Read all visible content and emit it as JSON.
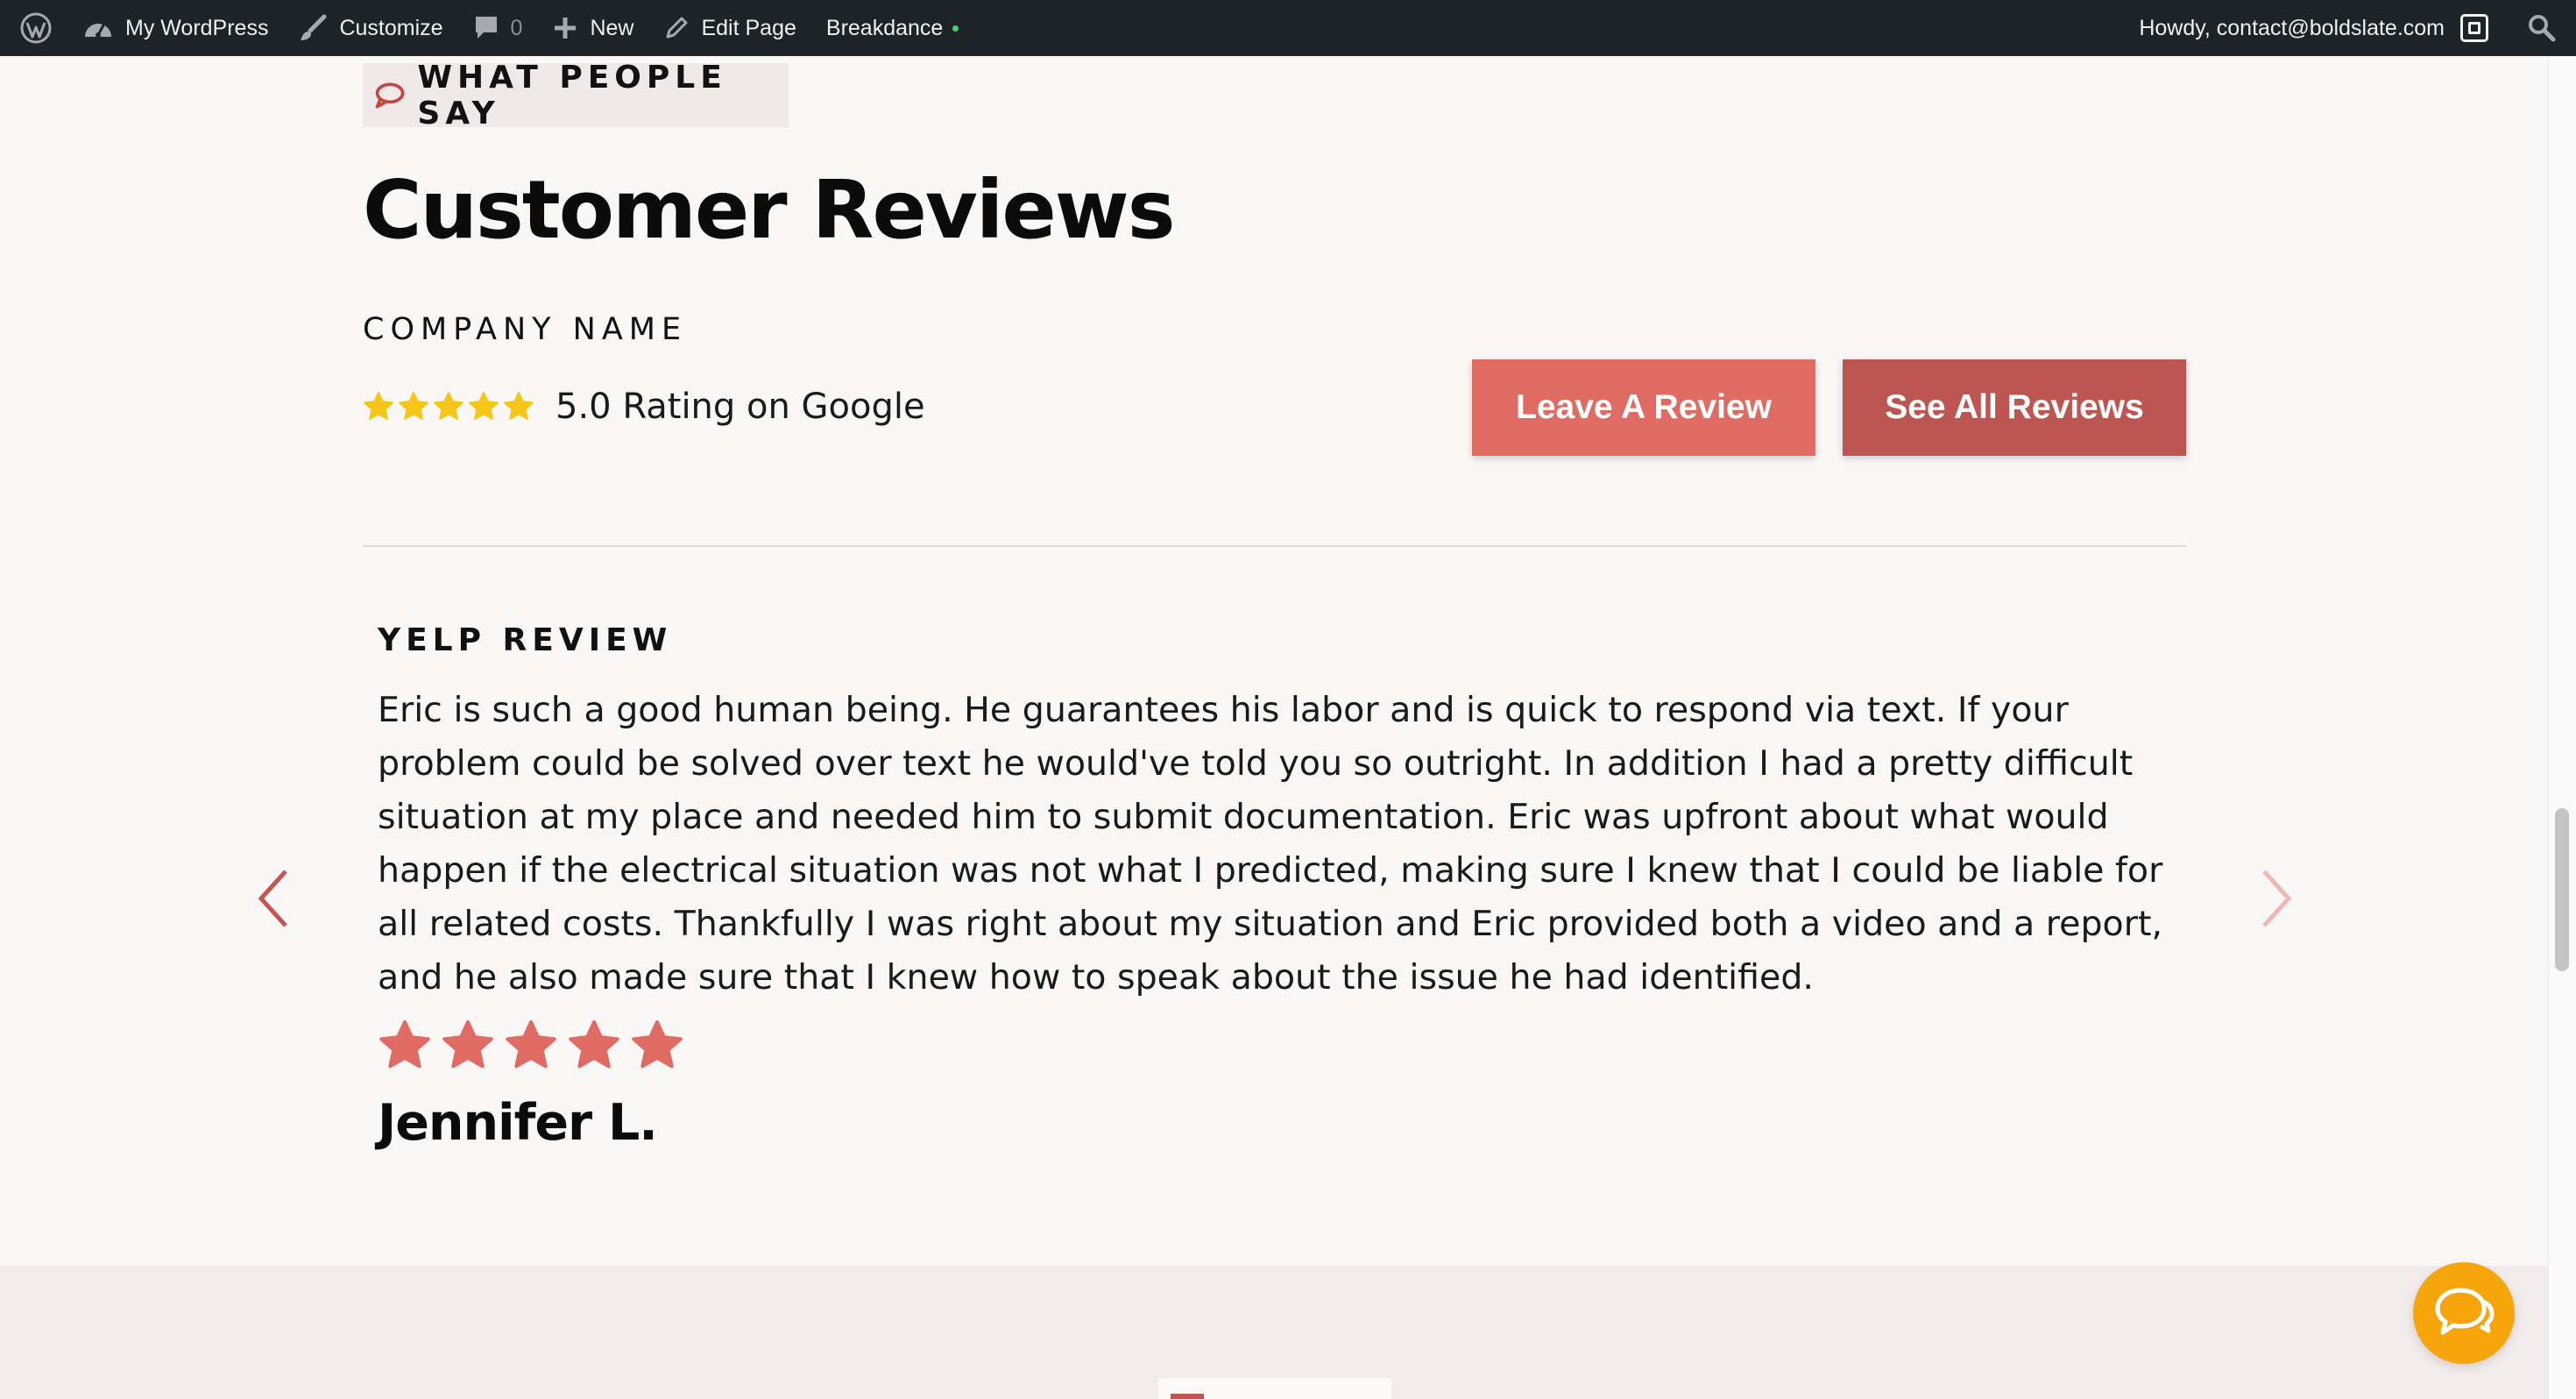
{
  "admin_bar": {
    "site_name": "My WordPress",
    "customize_label": "Customize",
    "comments_count": "0",
    "new_label": "New",
    "edit_page_label": "Edit Page",
    "builder_label": "Breakdance",
    "greeting": "Howdy, contact@boldslate.com"
  },
  "section": {
    "eyebrow": "WHAT PEOPLE SAY",
    "title": "Customer Reviews",
    "company_name": "COMPANY NAME",
    "rating_text": "5.0 Rating on Google",
    "rating_stars": 5,
    "leave_review_label": "Leave A Review",
    "see_all_label": "See All Reviews"
  },
  "review": {
    "source": "YELP REVIEW",
    "text": "Eric is such a good human being. He guarantees his labor and is quick to respond via text. If your problem could be solved over text he would've told you so outright. In addition I had a pretty difficult situation at my place and needed him to submit documentation. Eric was upfront about what would happen if the electrical situation was not what I predicted, making sure I knew that I could be liable for all related costs. Thankfully I was right about my situation and Eric provided both a video and a report, and he also made sure that I knew how to speak about the issue he had identified.",
    "stars": 5,
    "reviewer": "Jennifer L."
  },
  "colors": {
    "admin_bar_bg": "#1d2327",
    "accent_light": "#e06b63",
    "accent_dark": "#bd5651",
    "star_gold": "#f5c518",
    "chat_orange": "#f6a60a",
    "page_bg": "#faf7f7"
  },
  "icons": {
    "wp_logo": "wordpress-icon",
    "dashboard": "dashboard-icon",
    "customize": "brush-icon",
    "comments": "comment-icon",
    "new": "plus-icon",
    "edit": "pencil-icon",
    "search": "search-icon",
    "eyebrow": "speech-bubble-icon",
    "prev": "chevron-left-icon",
    "next": "chevron-right-icon",
    "chat": "chat-icon"
  }
}
